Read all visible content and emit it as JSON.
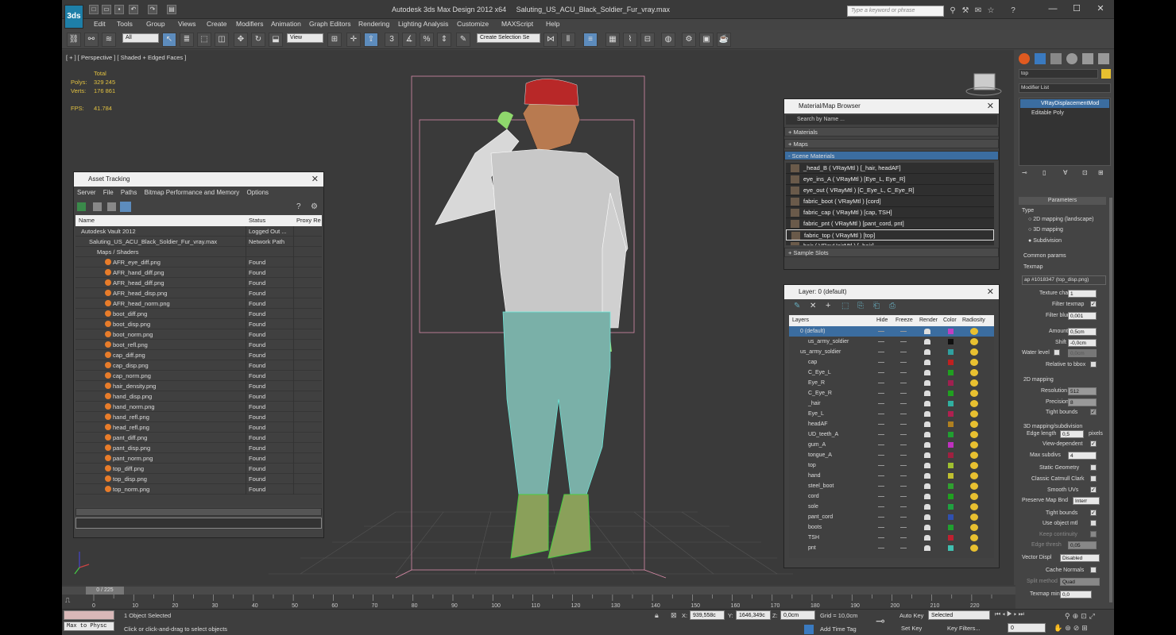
{
  "window": {
    "title": "Autodesk 3ds Max Design 2012 x64",
    "file": "Saluting_US_ACU_Black_Soldier_Fur_vray.max",
    "search_placeholder": "Type a keyword or phrase",
    "logo": "3ds"
  },
  "menu": [
    "Edit",
    "Tools",
    "Group",
    "Views",
    "Create",
    "Modifiers",
    "Animation",
    "Graph Editors",
    "Rendering",
    "Lighting Analysis",
    "Customize",
    "MAXScript",
    "Help"
  ],
  "toolbar": {
    "selection_filter": "All",
    "ref_coord": "View",
    "named_sel": "Create Selection Se",
    "snap_labels": [
      "3",
      "%"
    ]
  },
  "viewport": {
    "label": "[ + ] [ Perspective ] [ Shaded + Edged Faces ]",
    "stats_header": "Total",
    "polys_label": "Polys:",
    "polys": "329 245",
    "verts_label": "Verts:",
    "verts": "176 861",
    "fps_label": "FPS:",
    "fps": "41.784"
  },
  "asset_tracking": {
    "title": "Asset Tracking",
    "menu": [
      "Server",
      "File",
      "Paths",
      "Bitmap Performance and Memory",
      "Options"
    ],
    "columns": [
      "Name",
      "Status",
      "Proxy Re"
    ],
    "rows": [
      {
        "name": "Autodesk Vault 2012",
        "status": "Logged Out ...",
        "indent": 0,
        "kind": "vault"
      },
      {
        "name": "Saluting_US_ACU_Black_Soldier_Fur_vray.max",
        "status": "Network Path",
        "indent": 1,
        "kind": "file"
      },
      {
        "name": "Maps / Shaders",
        "status": "",
        "indent": 2,
        "kind": "folder"
      },
      {
        "name": "AFR_eye_diff.png",
        "status": "Found",
        "indent": 3,
        "kind": "map"
      },
      {
        "name": "AFR_hand_diff.png",
        "status": "Found",
        "indent": 3,
        "kind": "map"
      },
      {
        "name": "AFR_head_diff.png",
        "status": "Found",
        "indent": 3,
        "kind": "map"
      },
      {
        "name": "AFR_head_disp.png",
        "status": "Found",
        "indent": 3,
        "kind": "map"
      },
      {
        "name": "AFR_head_norm.png",
        "status": "Found",
        "indent": 3,
        "kind": "map"
      },
      {
        "name": "boot_diff.png",
        "status": "Found",
        "indent": 3,
        "kind": "map"
      },
      {
        "name": "boot_disp.png",
        "status": "Found",
        "indent": 3,
        "kind": "map"
      },
      {
        "name": "boot_norm.png",
        "status": "Found",
        "indent": 3,
        "kind": "map"
      },
      {
        "name": "boot_refl.png",
        "status": "Found",
        "indent": 3,
        "kind": "map"
      },
      {
        "name": "cap_diff.png",
        "status": "Found",
        "indent": 3,
        "kind": "map"
      },
      {
        "name": "cap_disp.png",
        "status": "Found",
        "indent": 3,
        "kind": "map"
      },
      {
        "name": "cap_norm.png",
        "status": "Found",
        "indent": 3,
        "kind": "map"
      },
      {
        "name": "hair_density.png",
        "status": "Found",
        "indent": 3,
        "kind": "map"
      },
      {
        "name": "hand_disp.png",
        "status": "Found",
        "indent": 3,
        "kind": "map"
      },
      {
        "name": "hand_norm.png",
        "status": "Found",
        "indent": 3,
        "kind": "map"
      },
      {
        "name": "hand_refl.png",
        "status": "Found",
        "indent": 3,
        "kind": "map"
      },
      {
        "name": "head_refl.png",
        "status": "Found",
        "indent": 3,
        "kind": "map"
      },
      {
        "name": "pant_diff.png",
        "status": "Found",
        "indent": 3,
        "kind": "map"
      },
      {
        "name": "pant_disp.png",
        "status": "Found",
        "indent": 3,
        "kind": "map"
      },
      {
        "name": "pant_norm.png",
        "status": "Found",
        "indent": 3,
        "kind": "map"
      },
      {
        "name": "top_diff.png",
        "status": "Found",
        "indent": 3,
        "kind": "map"
      },
      {
        "name": "top_disp.png",
        "status": "Found",
        "indent": 3,
        "kind": "map"
      },
      {
        "name": "top_norm.png",
        "status": "Found",
        "indent": 3,
        "kind": "map"
      }
    ]
  },
  "material_browser": {
    "title": "Material/Map Browser",
    "search": "Search by Name ...",
    "sections": {
      "materials": "+ Materials",
      "maps": "+ Maps",
      "scene": "- Scene Materials",
      "sample": "+ Sample Slots"
    },
    "items": [
      "_head_B  ( VRayMtl ) [_hair, headAF]",
      "eye_ins_A  ( VRayMtl ) [Eye_L, Eye_R]",
      "eye_out  ( VRayMtl ) [C_Eye_L, C_Eye_R]",
      "fabric_boot  ( VRayMtl ) [cord]",
      "fabric_cap  ( VRayMtl ) [cap, TSH]",
      "fabric_pnt  ( VRayMtl ) [pant_cord, pnt]",
      "fabric_top  ( VRayMtl ) [top]",
      "hair  ( VRayHairMtl ) [_hair]"
    ]
  },
  "layers": {
    "title": "Layer: 0 (default)",
    "columns": [
      "Layers",
      "Hide",
      "Freeze",
      "Render",
      "Color",
      "Radiosity"
    ],
    "rows": [
      {
        "name": "0 (default)",
        "indent": 0,
        "color": "#c040c0",
        "selected": true
      },
      {
        "name": "us_army_soldier",
        "indent": 1,
        "color": "#101010"
      },
      {
        "name": "us_army_soldier",
        "indent": 0,
        "color": "#30a0a0"
      },
      {
        "name": "cap",
        "indent": 1,
        "color": "#c02020"
      },
      {
        "name": "C_Eye_L",
        "indent": 1,
        "color": "#20a020"
      },
      {
        "name": "Eye_R",
        "indent": 1,
        "color": "#a02050"
      },
      {
        "name": "C_Eye_R",
        "indent": 1,
        "color": "#20a020"
      },
      {
        "name": "_hair",
        "indent": 1,
        "color": "#30b0a0"
      },
      {
        "name": "Eye_L",
        "indent": 1,
        "color": "#b02050"
      },
      {
        "name": "headAF",
        "indent": 1,
        "color": "#b08020"
      },
      {
        "name": "UD_teeth_A",
        "indent": 1,
        "color": "#20a030"
      },
      {
        "name": "gum_A",
        "indent": 1,
        "color": "#c030c0"
      },
      {
        "name": "tongue_A",
        "indent": 1,
        "color": "#a02040"
      },
      {
        "name": "top",
        "indent": 1,
        "color": "#a0c030"
      },
      {
        "name": "hand",
        "indent": 1,
        "color": "#c0c030"
      },
      {
        "name": "steel_boot",
        "indent": 1,
        "color": "#30a030"
      },
      {
        "name": "cord",
        "indent": 1,
        "color": "#20a020"
      },
      {
        "name": "sole",
        "indent": 1,
        "color": "#20a040"
      },
      {
        "name": "pant_cord",
        "indent": 1,
        "color": "#3050b0"
      },
      {
        "name": "boots",
        "indent": 1,
        "color": "#20a030"
      },
      {
        "name": "TSH",
        "indent": 1,
        "color": "#c02030"
      },
      {
        "name": "pnt",
        "indent": 1,
        "color": "#40c0b0"
      }
    ]
  },
  "command_panel": {
    "object_name": "top",
    "modifier_list": "Modifier List",
    "stack": [
      "VRayDisplacementMod",
      "Editable Poly"
    ],
    "rollout_title": "Parameters",
    "type_label": "Type",
    "types": [
      "2D mapping (landscape)",
      "3D mapping",
      "Subdivision"
    ],
    "common_label": "Common params",
    "texmap_label": "Texmap",
    "texmap_value": "ap #1018347 (top_disp.png)",
    "params": [
      {
        "label": "Texture chan",
        "value": "1"
      },
      {
        "label": "Filter texmap",
        "check": "✓"
      },
      {
        "label": "Filter blur",
        "value": "0,001"
      },
      {
        "label": "Amount",
        "value": "0,5cm"
      },
      {
        "label": "Shift",
        "value": "-0,0cm"
      },
      {
        "label": "Water level",
        "value": "0,0cm",
        "disabled": true
      },
      {
        "label": "Relative to bbox",
        "check": ""
      }
    ],
    "mapping2d_label": "2D mapping",
    "resolution_label": "Resolution",
    "resolution": "512",
    "precision_label": "Precision",
    "precision": "8",
    "tight_label": "Tight bounds",
    "subdiv_label": "3D mapping/subdivision",
    "edge_label": "Edge length",
    "edge_value": "0,5",
    "pixels": "pixels",
    "view_dep": "View-dependent",
    "max_subdivs_label": "Max subdivs",
    "max_subdivs": "4",
    "checks": [
      {
        "label": "Static Geometry",
        "check": ""
      },
      {
        "label": "Classic Catmull Clark",
        "check": ""
      },
      {
        "label": "Smooth UVs",
        "check": "✓"
      }
    ],
    "preserve_label": "Preserve Map Bnd",
    "preserve_value": "Interr",
    "tight2_label": "Tight bounds",
    "use_obj": "Use object mtl",
    "keep_cont": "Keep continuity",
    "edge_thresh_label": "Edge thresh",
    "edge_thresh": "0,05",
    "vector_label": "Vector Displ",
    "vector_value": "Disabled",
    "cache_normals": "Cache Normals",
    "split_label": "Split method",
    "split_value": "Quad",
    "texmap_min_label": "Texmap min",
    "texmap_min": "0,0"
  },
  "timeline": {
    "frame": "0 / 225",
    "ticks": [
      "0",
      "10",
      "20",
      "30",
      "40",
      "50",
      "60",
      "70",
      "80",
      "90",
      "100",
      "110",
      "120",
      "130",
      "140",
      "150",
      "160",
      "170",
      "180",
      "190",
      "200",
      "210",
      "220"
    ]
  },
  "status": {
    "maxscript": "Max to Physc",
    "selected": "1 Object Selected",
    "prompt": "Click or click-and-drag to select objects",
    "x_label": "X:",
    "x": "939,558c",
    "y_label": "Y:",
    "y": "1646,349c",
    "z_label": "Z:",
    "z": "0,0cm",
    "grid": "Grid = 10,0cm",
    "add_time_tag": "Add Time Tag",
    "auto_key": "Auto Key",
    "set_key": "Set Key",
    "key_mode": "Selected",
    "key_filters": "Key Filters...",
    "frame_field": "0"
  }
}
